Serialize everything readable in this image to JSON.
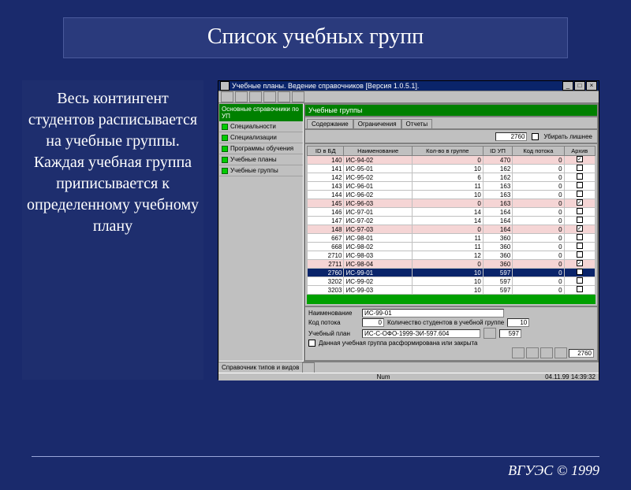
{
  "slide": {
    "title": "Список учебных групп",
    "description": "Весь контингент студентов расписывается на учебные группы. Каждая учебная группа приписывается к определенному учебному плану",
    "footer": "ВГУЭС © 1999"
  },
  "app": {
    "window_title": "Учебные планы. Ведение справочников [Версия 1.0.5.1].",
    "side_header": "Основные справочники по УП",
    "side_items": [
      "Специальности",
      "Специализации",
      "Программы обучения",
      "Учебные планы",
      "Учебные группы"
    ],
    "main_header": "Учебные группы",
    "tabs": [
      "Содержание",
      "Ограничения",
      "Отчеты"
    ],
    "filter_value": "2760",
    "filter_check_label": "Убирать лишнее",
    "columns": [
      "ID в БД",
      "Наименование",
      "Кол-во в группе",
      "ID УП",
      "Код потока",
      "Архив"
    ],
    "rows": [
      {
        "id": "140",
        "name": "ИС-94-02",
        "cnt": "0",
        "up": "470",
        "kod": "0",
        "arc": true,
        "pink": true
      },
      {
        "id": "141",
        "name": "ИС-95-01",
        "cnt": "10",
        "up": "162",
        "kod": "0",
        "arc": false,
        "pink": false
      },
      {
        "id": "142",
        "name": "ИС-95-02",
        "cnt": "6",
        "up": "162",
        "kod": "0",
        "arc": false,
        "pink": false
      },
      {
        "id": "143",
        "name": "ИС-96-01",
        "cnt": "11",
        "up": "163",
        "kod": "0",
        "arc": false,
        "pink": false
      },
      {
        "id": "144",
        "name": "ИС-96-02",
        "cnt": "10",
        "up": "163",
        "kod": "0",
        "arc": false,
        "pink": false
      },
      {
        "id": "145",
        "name": "ИС-96-03",
        "cnt": "0",
        "up": "163",
        "kod": "0",
        "arc": true,
        "pink": true
      },
      {
        "id": "146",
        "name": "ИС-97-01",
        "cnt": "14",
        "up": "164",
        "kod": "0",
        "arc": false,
        "pink": false
      },
      {
        "id": "147",
        "name": "ИС-97-02",
        "cnt": "14",
        "up": "164",
        "kod": "0",
        "arc": false,
        "pink": false
      },
      {
        "id": "148",
        "name": "ИС-97-03",
        "cnt": "0",
        "up": "164",
        "kod": "0",
        "arc": true,
        "pink": true
      },
      {
        "id": "667",
        "name": "ИС-98-01",
        "cnt": "11",
        "up": "360",
        "kod": "0",
        "arc": false,
        "pink": false
      },
      {
        "id": "668",
        "name": "ИС-98-02",
        "cnt": "11",
        "up": "360",
        "kod": "0",
        "arc": false,
        "pink": false
      },
      {
        "id": "2710",
        "name": "ИС-98-03",
        "cnt": "12",
        "up": "360",
        "kod": "0",
        "arc": false,
        "pink": false
      },
      {
        "id": "2711",
        "name": "ИС-98-04",
        "cnt": "0",
        "up": "360",
        "kod": "0",
        "arc": true,
        "pink": true
      },
      {
        "id": "2760",
        "name": "ИС-99-01",
        "cnt": "10",
        "up": "597",
        "kod": "0",
        "arc": false,
        "pink": false,
        "sel": true
      },
      {
        "id": "3202",
        "name": "ИС-99-02",
        "cnt": "10",
        "up": "597",
        "kod": "0",
        "arc": false,
        "pink": false
      },
      {
        "id": "3203",
        "name": "ИС-99-03",
        "cnt": "10",
        "up": "597",
        "kod": "0",
        "arc": false,
        "pink": false
      }
    ],
    "form": {
      "name_label": "Наименование",
      "name_value": "ИС-99-01",
      "kod_label": "Код потока",
      "kod_value": "0",
      "cnt_label": "Количество студентов в учебной группе",
      "cnt_value": "10",
      "plan_label": "Учебный план",
      "plan_value": "ИС-С-ОФО-1999-ЭИ-597.604",
      "plan_id": "597",
      "arc_label": "Данная учебная группа расформирована или закрыта"
    },
    "bottom_label": "Справочник типов и видов",
    "status_id": "2760",
    "status_num": "Num",
    "status_time": "04.11.99 14:39:32"
  }
}
